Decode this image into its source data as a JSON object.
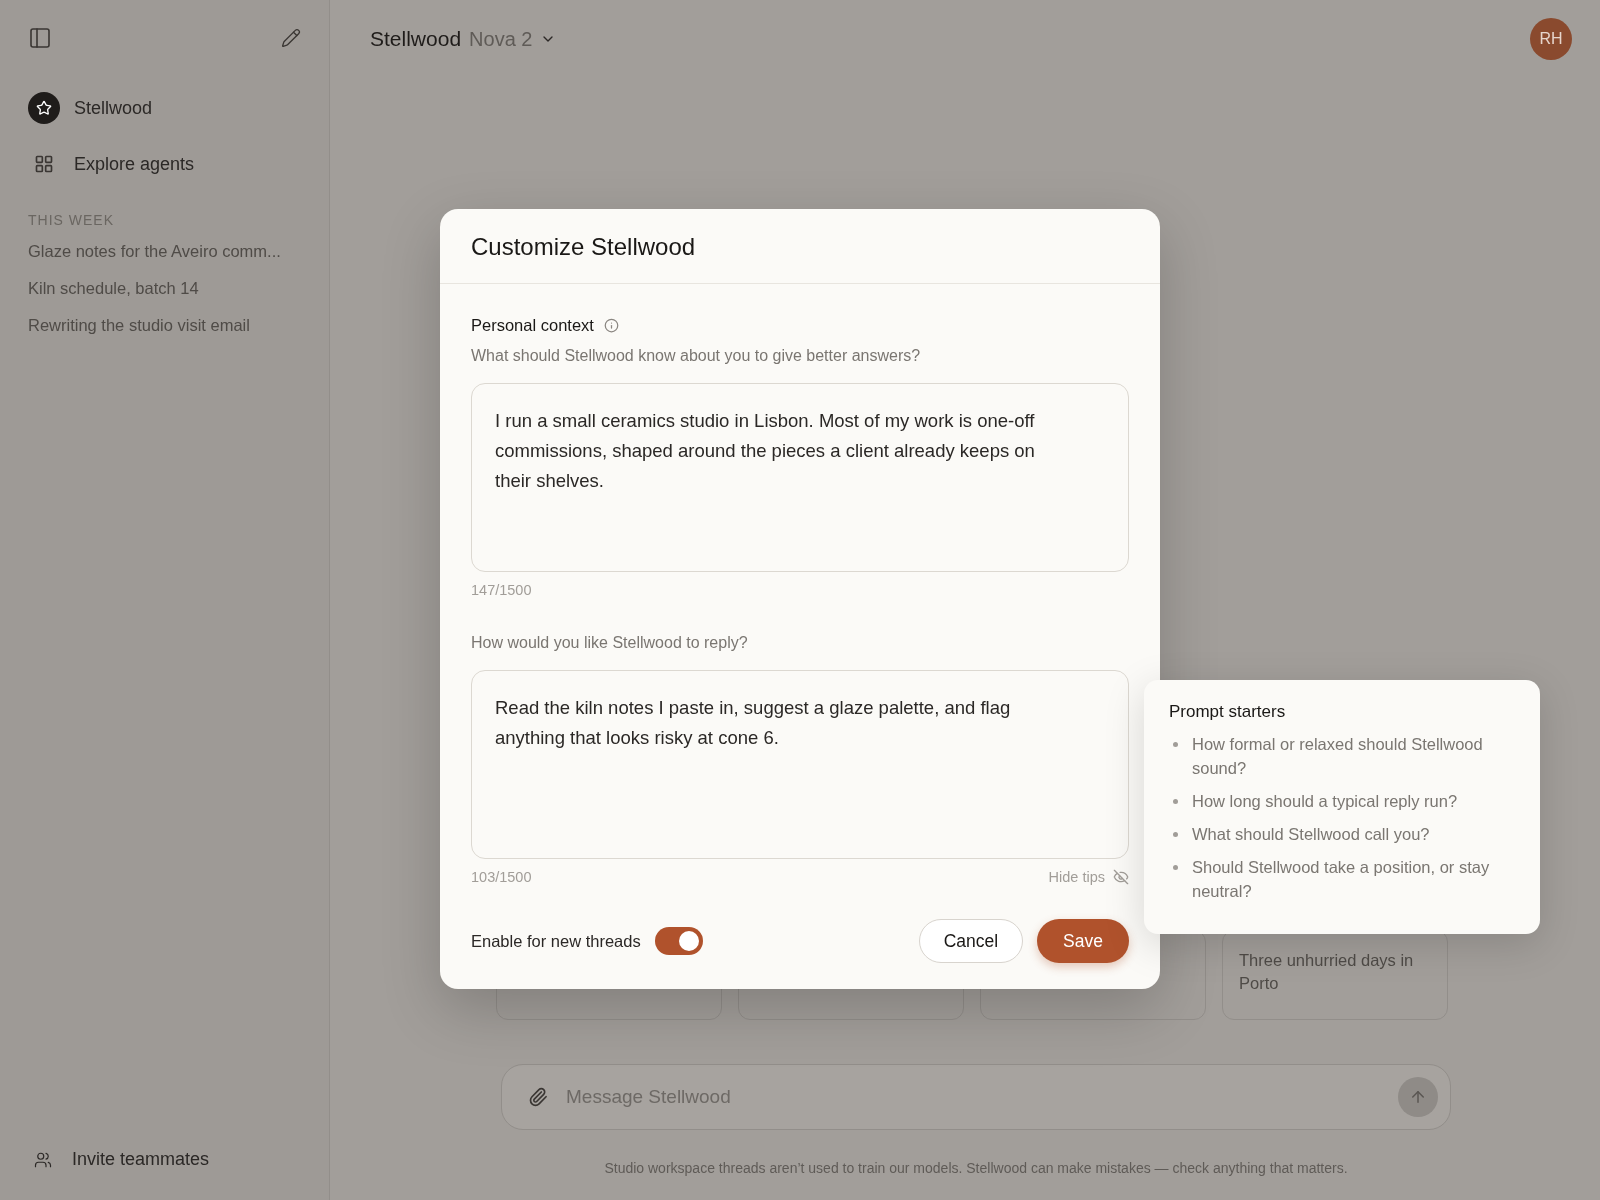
{
  "sidebar": {
    "items": [
      {
        "kind": "agent",
        "label": "Stellwood",
        "selected": false
      },
      {
        "kind": "explore",
        "label": "Explore agents",
        "selected": false
      }
    ],
    "section_title": "THIS WEEK",
    "threads": [
      "Glaze notes for the Aveiro comm...",
      "Kiln schedule, batch 14",
      "Rewriting the studio visit email"
    ],
    "invite": "Invite teammates"
  },
  "header": {
    "title": "Stellwood",
    "model": "Nova 2",
    "avatar": "RH"
  },
  "suggestion_cards": [
    {
      "kind": "hidden"
    },
    {
      "kind": "hidden"
    },
    {
      "kind": "hidden"
    },
    {
      "kind": "text",
      "text": "Three unhurried days in Porto"
    }
  ],
  "composer": {
    "placeholder": "Message Stellwood"
  },
  "footnote": "Studio workspace threads aren’t used to train our models. Stellwood can make mistakes — check anything that matters.",
  "dialog": {
    "title": "Customize Stellwood",
    "section_label": "Personal context",
    "context_hint": "What should Stellwood know about you to give better answers?",
    "context_value": "I run a small ceramics studio in Lisbon. Most of my work is one-off commissions, shaped around the pieces a client already keeps on their shelves.",
    "context_count": "147/1500",
    "reply_hint": "How would you like Stellwood to reply?",
    "reply_value": "Read the kiln notes I paste in, suggest a glaze palette, and flag anything that looks risky at cone 6.",
    "reply_count": "103/1500",
    "hide_tips": "Hide tips",
    "enable": {
      "label": "Enable for new threads",
      "on": true
    },
    "buttons": [
      "Cancel",
      "Save"
    ]
  },
  "prompt_starters": {
    "title": "Prompt starters",
    "items": [
      "How formal or relaxed should Stellwood sound?",
      "How long should a typical reply run?",
      "What should Stellwood call you?",
      "Should Stellwood take a position, or stay neutral?"
    ]
  }
}
